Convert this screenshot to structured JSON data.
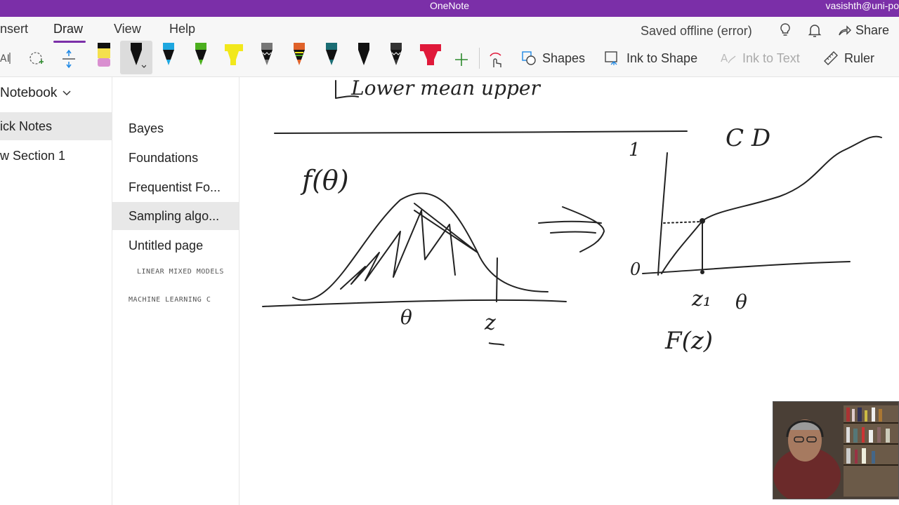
{
  "titlebar": {
    "app_name": "OneNote",
    "user": "vasishth@uni-po"
  },
  "ribbon": {
    "tabs": [
      {
        "label": "nsert"
      },
      {
        "label": "Draw"
      },
      {
        "label": "View"
      },
      {
        "label": "Help"
      }
    ],
    "status": "Saved offline (error)",
    "share_label": "Share",
    "tools": {
      "shapes": "Shapes",
      "ink_to_shape": "Ink to Shape",
      "ink_to_text": "Ink to Text",
      "ruler": "Ruler"
    },
    "pens": [
      {
        "name": "highlighter-pink",
        "color": "#d98fd0"
      },
      {
        "name": "pen-black-selected",
        "color": "#222222"
      },
      {
        "name": "pen-cyan",
        "color": "#1ea7e0"
      },
      {
        "name": "pen-green",
        "color": "#4caf1e"
      },
      {
        "name": "highlighter-yellow",
        "color": "#f2e81c"
      },
      {
        "name": "pen-galaxy-gray",
        "color": "#777777"
      },
      {
        "name": "pen-rainbow",
        "color": "#e0622a"
      },
      {
        "name": "pen-teal",
        "color": "#1b6d74"
      },
      {
        "name": "pen-black",
        "color": "#111111"
      },
      {
        "name": "pen-black-glitter",
        "color": "#333333"
      },
      {
        "name": "highlighter-red",
        "color": "#e0193a"
      }
    ]
  },
  "notebook": {
    "title": "Notebook",
    "sections": [
      {
        "label": "ick Notes"
      },
      {
        "label": "w Section 1"
      }
    ]
  },
  "pages": [
    {
      "label": "Bayes"
    },
    {
      "label": "Foundations"
    },
    {
      "label": "Frequentist Fo..."
    },
    {
      "label": "Sampling algo..."
    },
    {
      "label": "Untitled page"
    },
    {
      "label": "LINEAR MIXED MODELS"
    },
    {
      "label": "MACHINE LEARNING C"
    }
  ],
  "canvas": {
    "ink_labels": {
      "top_text": "Lower mean upper",
      "density_label": "f(θ)",
      "theta_axis": "θ",
      "z_label": "z",
      "cdf_label": "C D",
      "one_label": "1",
      "zero_label": "0",
      "z1_label": "z₁",
      "theta2_label": "θ",
      "F_label": "F(z)"
    }
  },
  "colors": {
    "accent": "#7b2fa8",
    "ink": "#222222"
  }
}
